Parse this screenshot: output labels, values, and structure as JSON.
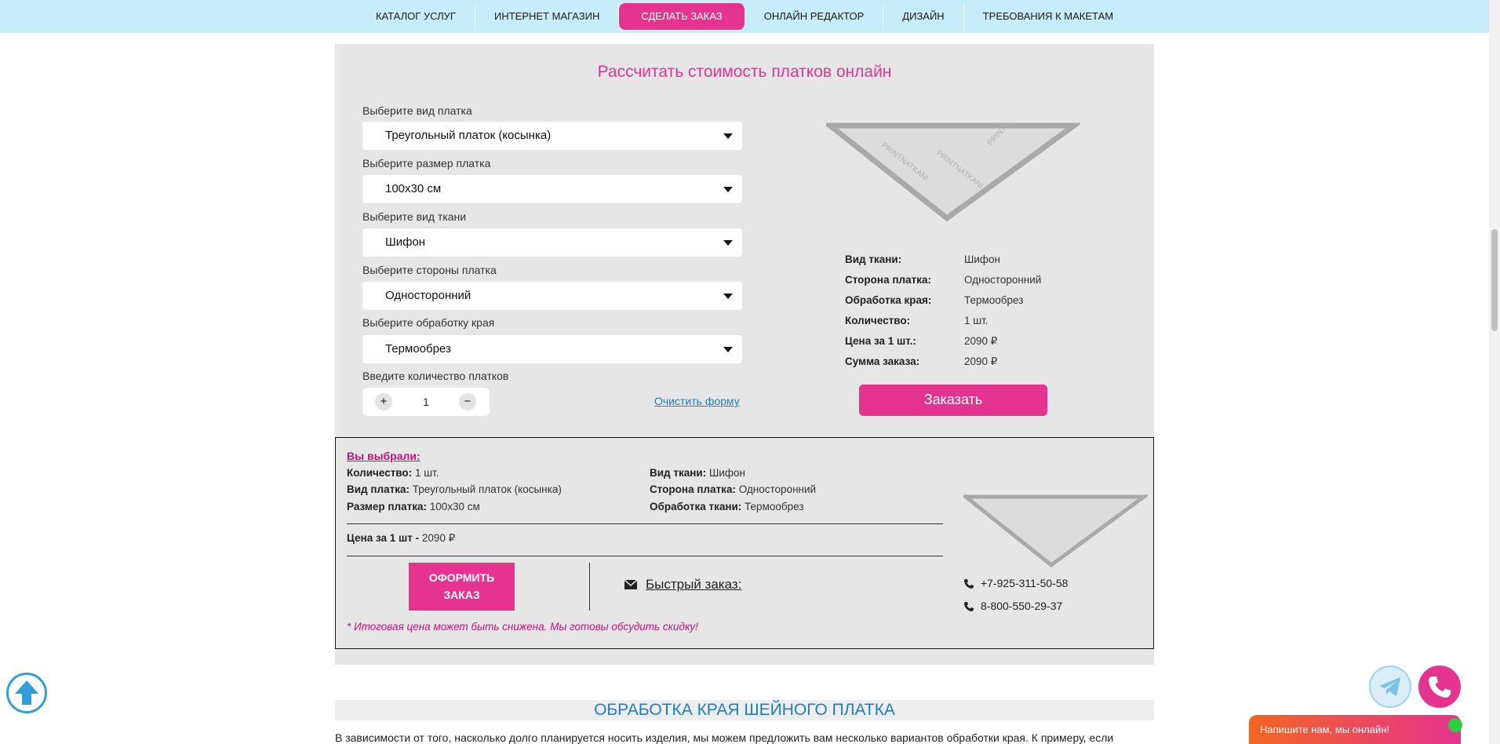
{
  "nav": {
    "items": [
      {
        "label": "КАТАЛОГ УСЛУГ",
        "active": false
      },
      {
        "label": "ИНТЕРНЕТ МАГАЗИН",
        "active": false
      },
      {
        "label": "СДЕЛАТЬ ЗАКАЗ",
        "active": true
      },
      {
        "label": "ОНЛАЙН РЕДАКТОР",
        "active": false
      },
      {
        "label": "ДИЗАЙН",
        "active": false
      },
      {
        "label": "ТРЕБОВАНИЯ К МАКЕТАМ",
        "active": false
      }
    ]
  },
  "calculator": {
    "title": "Рассчитать стоимость платков онлайн",
    "fields": {
      "type": {
        "label": "Выберите вид платка",
        "value": "Треугольный платок (косынка)"
      },
      "size": {
        "label": "Выберите размер платка",
        "value": "100x30 см"
      },
      "fabric": {
        "label": "Выберите вид ткани",
        "value": "Шифон"
      },
      "sides": {
        "label": "Выберите стороны платка",
        "value": "Односторонний"
      },
      "edge": {
        "label": "Выберите обработку края",
        "value": "Термообрез"
      }
    },
    "quantity": {
      "label": "Введите количество платков",
      "value": "1",
      "plus": "+",
      "minus": "−"
    },
    "clear_label": "Очистить форму",
    "summary": {
      "fabric": {
        "k": "Вид ткани:",
        "v": "Шифон"
      },
      "side": {
        "k": "Сторона платка:",
        "v": "Односторонний"
      },
      "edge": {
        "k": "Обработка края:",
        "v": "Термообрез"
      },
      "qty": {
        "k": "Количество:",
        "v": "1 шт."
      },
      "unit_price": {
        "k": "Цена за 1 шт.:",
        "v": "2090 ₽"
      },
      "total": {
        "k": "Сумма заказа:",
        "v": "2090 ₽"
      }
    },
    "order_label": "Заказать",
    "preview_watermark": "PRINTNATKANI"
  },
  "chosen": {
    "title": "Вы выбрали:",
    "qty": {
      "k": "Количество:",
      "v": "1 шт."
    },
    "type": {
      "k": "Вид платка:",
      "v": "Треугольный платок (косынка)"
    },
    "size": {
      "k": "Размер платка:",
      "v": "100x30 см"
    },
    "fabric": {
      "k": "Вид ткани:",
      "v": "Шифон"
    },
    "side": {
      "k": "Сторона платка:",
      "v": "Односторонний"
    },
    "processing": {
      "k": "Обработка ткани:",
      "v": "Термообрез"
    },
    "unit_price": {
      "k": "Цена за 1 шт -",
      "v": "2090 ₽"
    },
    "checkout_line1": "ОФОРМИТЬ",
    "checkout_line2": "ЗАКАЗ",
    "fast_order": "Быстрый заказ:",
    "note_star": "*",
    "note": "Итоговая цена может быть снижена. Мы готовы обсудить скидку!",
    "phones": [
      "+7-925-311-50-58",
      "8-800-550-29-37"
    ]
  },
  "section": {
    "title": "ОБРАБОТКА КРАЯ ШЕЙНОГО ПЛАТКА",
    "text": "В зависимости от того, насколько долго планируется носить изделия, мы можем предложить вам несколько вариантов обработки края. К примеру, если"
  },
  "chat": {
    "label": "Напишите нам, мы онлайн!"
  },
  "colors": {
    "accent": "#e4348f",
    "nav_bg": "#c7ecfa",
    "link": "#1f7fc4",
    "panel": "#e6e6e6"
  }
}
